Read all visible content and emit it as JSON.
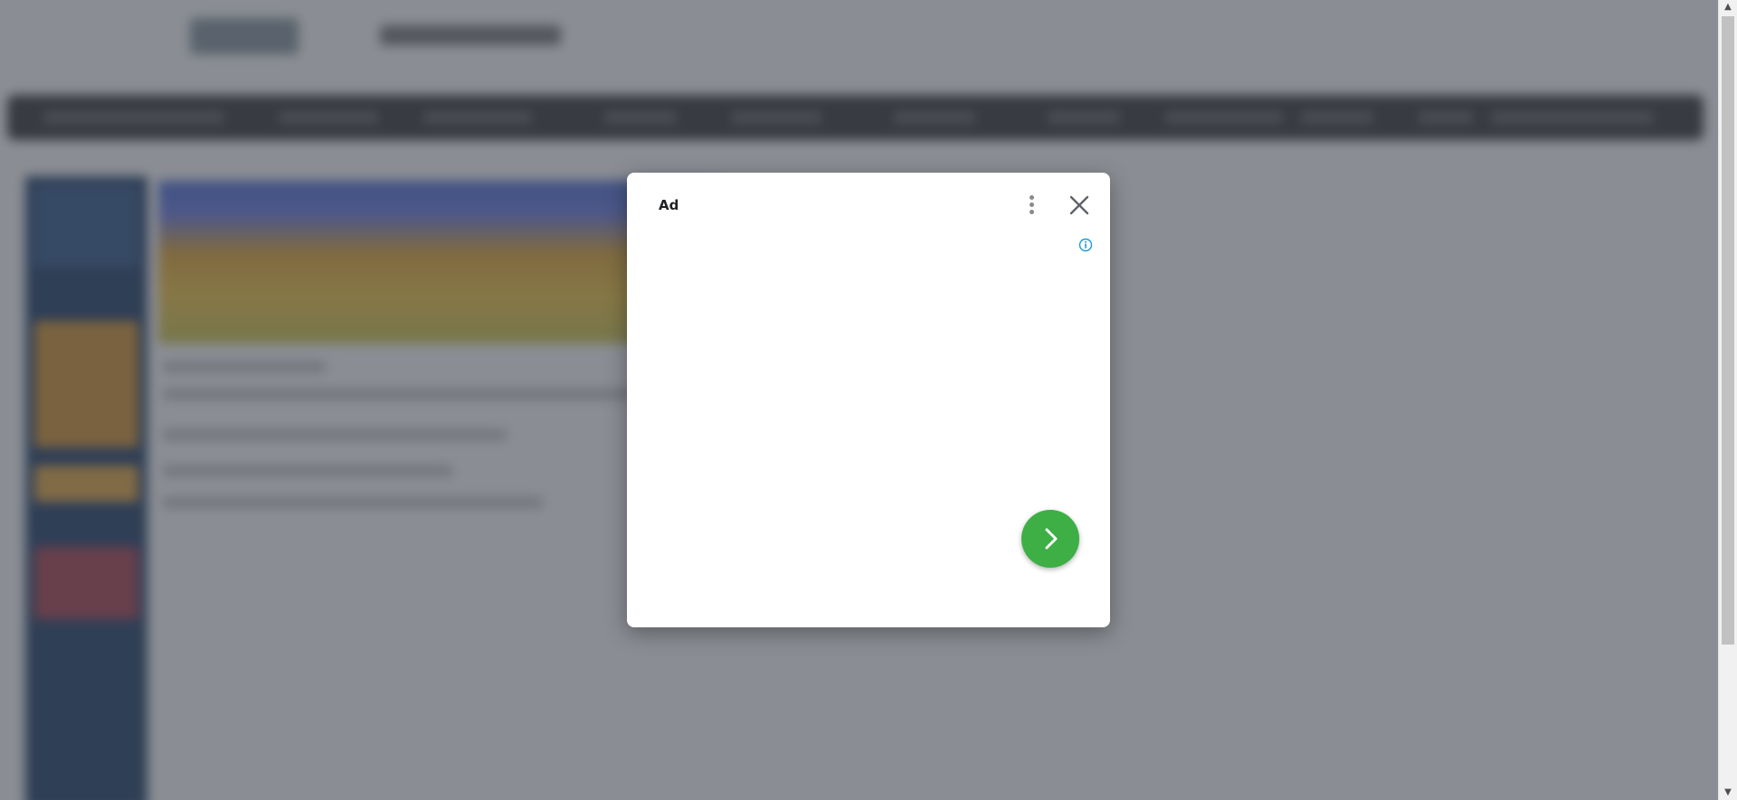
{
  "ad_dialog": {
    "label": "Ad",
    "menu_icon": "more-vert-icon",
    "close_icon": "close-icon",
    "info_icon": "info-icon",
    "next_icon": "chevron-right-icon"
  },
  "colors": {
    "overlay": "#464a54",
    "dialog_bg": "#ffffff",
    "next_button": "#3daf45",
    "info_icon": "#1a9cd8",
    "sidebar": "#0d2d5a",
    "navbar": "#222222"
  }
}
